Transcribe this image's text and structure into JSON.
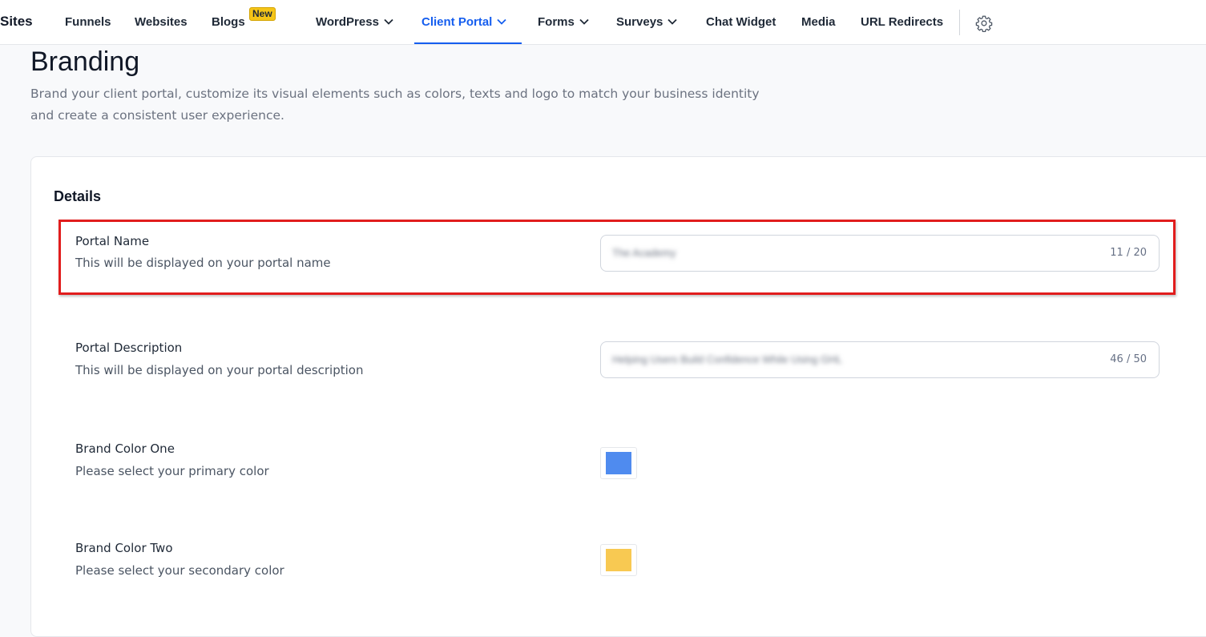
{
  "nav": {
    "section_title": "Sites",
    "items": [
      {
        "label": "Funnels"
      },
      {
        "label": "Websites"
      },
      {
        "label": "Blogs",
        "badge": "New"
      },
      {
        "label": "WordPress"
      },
      {
        "label": "Client Portal"
      },
      {
        "label": "Forms"
      },
      {
        "label": "Surveys"
      },
      {
        "label": "Chat Widget"
      },
      {
        "label": "Media"
      },
      {
        "label": "URL Redirects"
      }
    ],
    "active_item": "Client Portal",
    "settings_icon": "gear-icon"
  },
  "page": {
    "title": "Branding",
    "subtitle": "Brand your client portal, customize its visual elements such as colors, texts and logo to match your business identity and create a consistent user experience."
  },
  "details": {
    "title": "Details",
    "portal_name": {
      "label": "Portal Name",
      "help": "This will be displayed on your portal name",
      "value": "The Academy",
      "count": "11 / 20"
    },
    "portal_description": {
      "label": "Portal Description",
      "help": "This will be displayed on your portal description",
      "value": "Helping Users Build Confidence While Using GHL",
      "count": "46 / 50"
    },
    "brand_color_one": {
      "label": "Brand Color One",
      "help": "Please select your primary color",
      "color": "#4f8bef"
    },
    "brand_color_two": {
      "label": "Brand Color Two",
      "help": "Please select your secondary color",
      "color": "#f8c952"
    }
  },
  "colors": {
    "accent": "#155eef",
    "highlight": "#e11d1d",
    "badge": "#f5c518"
  }
}
